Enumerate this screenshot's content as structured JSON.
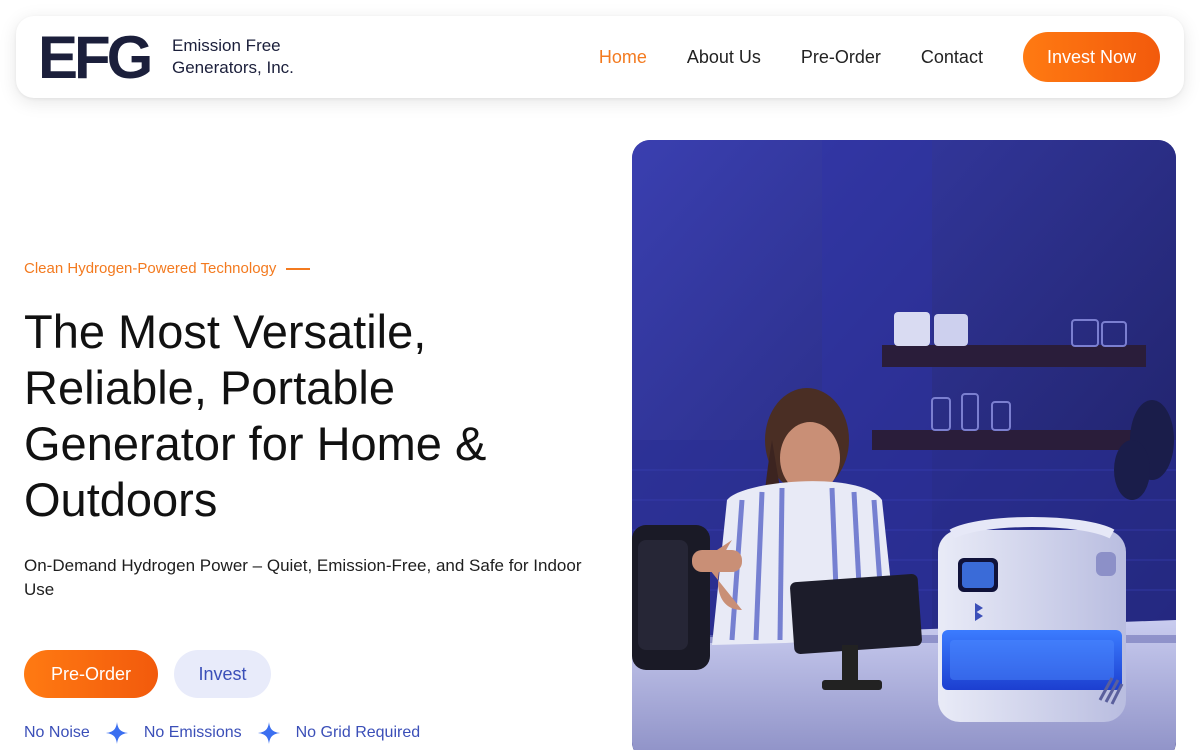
{
  "brand": {
    "logo_letters": "EFG",
    "name_line1": "Emission Free",
    "name_line2": "Generators, Inc."
  },
  "nav": {
    "items": [
      {
        "label": "Home",
        "active": true
      },
      {
        "label": "About Us",
        "active": false
      },
      {
        "label": "Pre-Order",
        "active": false
      },
      {
        "label": "Contact",
        "active": false
      }
    ],
    "cta_label": "Invest Now"
  },
  "hero": {
    "tagline": "Clean Hydrogen-Powered Technology",
    "headline": "The Most Versatile, Reliable, Portable Generator for Home & Outdoors",
    "subhead": "On-Demand Hydrogen Power – Quiet, Emission-Free, and Safe for Indoor Use",
    "primary_button": "Pre-Order",
    "secondary_button": "Invest",
    "features": [
      "No Noise",
      "No Emissions",
      "No Grid Required"
    ],
    "image_icon": "kitchen-photo-woman-with-hydrogen-generator"
  },
  "colors": {
    "accent_orange": "#f37a1f",
    "accent_blue": "#3b4fb8",
    "navy": "#1b1f3b"
  }
}
